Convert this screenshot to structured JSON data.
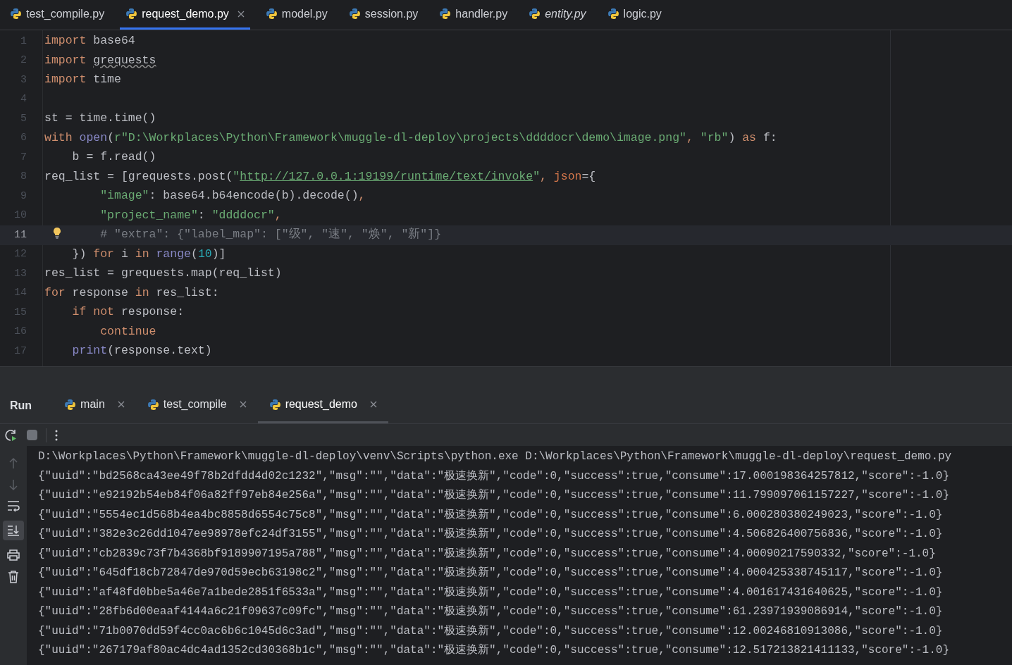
{
  "editor_tabs": [
    {
      "label": "test_compile.py",
      "selected": false,
      "preview": false
    },
    {
      "label": "request_demo.py",
      "selected": true,
      "preview": false
    },
    {
      "label": "model.py",
      "selected": false,
      "preview": false
    },
    {
      "label": "session.py",
      "selected": false,
      "preview": false
    },
    {
      "label": "handler.py",
      "selected": false,
      "preview": false
    },
    {
      "label": "entity.py",
      "selected": false,
      "preview": true
    },
    {
      "label": "logic.py",
      "selected": false,
      "preview": false
    }
  ],
  "code_lines": [
    {
      "number": "1",
      "current": false,
      "tokens": [
        {
          "kind": "kw",
          "text": "import "
        },
        {
          "kind": "plain",
          "text": "base64"
        }
      ]
    },
    {
      "number": "2",
      "current": false,
      "tokens": [
        {
          "kind": "kw",
          "text": "import "
        },
        {
          "kind": "warn",
          "text": "grequests"
        }
      ]
    },
    {
      "number": "3",
      "current": false,
      "tokens": [
        {
          "kind": "kw",
          "text": "import "
        },
        {
          "kind": "plain",
          "text": "time"
        }
      ]
    },
    {
      "number": "4",
      "current": false
    },
    {
      "number": "5",
      "current": false,
      "tokens": [
        {
          "kind": "plain",
          "text": "st = time.time()"
        }
      ]
    },
    {
      "number": "6",
      "current": false,
      "tokens": [
        {
          "kind": "kw",
          "text": "with "
        },
        {
          "kind": "fn",
          "text": "open"
        },
        {
          "kind": "plain",
          "text": "("
        },
        {
          "kind": "str",
          "text": "r\"D:\\Workplaces\\Python\\Framework\\muggle-dl-deploy\\projects\\ddddocr\\demo\\image.png\""
        },
        {
          "kind": "punct",
          "text": ", "
        },
        {
          "kind": "str",
          "text": "\"rb\""
        },
        {
          "kind": "plain",
          "text": ") "
        },
        {
          "kind": "kw",
          "text": "as "
        },
        {
          "kind": "plain",
          "text": "f:"
        }
      ]
    },
    {
      "number": "7",
      "current": false,
      "tokens": [
        {
          "kind": "plain",
          "text": "    b = f.read()"
        }
      ]
    },
    {
      "number": "8",
      "current": false,
      "tokens": [
        {
          "kind": "plain",
          "text": "req_list = [grequests.post("
        },
        {
          "kind": "str",
          "text": "\""
        },
        {
          "kind": "link",
          "text": "http://127.0.0.1:19199/runtime/text/invoke"
        },
        {
          "kind": "str",
          "text": "\""
        },
        {
          "kind": "punct",
          "text": ", "
        },
        {
          "kind": "param",
          "text": "json"
        },
        {
          "kind": "plain",
          "text": "={"
        }
      ]
    },
    {
      "number": "9",
      "current": false,
      "tokens": [
        {
          "kind": "str",
          "text": "        \"image\""
        },
        {
          "kind": "plain",
          "text": ": base64.b64encode(b).decode()"
        },
        {
          "kind": "punct",
          "text": ","
        }
      ]
    },
    {
      "number": "10",
      "current": false,
      "tokens": [
        {
          "kind": "str",
          "text": "        \"project_name\""
        },
        {
          "kind": "plain",
          "text": ": "
        },
        {
          "kind": "str",
          "text": "\"ddddocr\""
        },
        {
          "kind": "punct",
          "text": ","
        }
      ]
    },
    {
      "number": "11",
      "current": true,
      "bulb": true,
      "tokens": [
        {
          "kind": "comment",
          "text": "# \"extra\": {\"label_map\": [\"级\", \"速\", \"焕\", \"新\"]}"
        }
      ]
    },
    {
      "number": "12",
      "current": false,
      "tokens": [
        {
          "kind": "plain",
          "text": "    }) "
        },
        {
          "kind": "kw",
          "text": "for "
        },
        {
          "kind": "plain",
          "text": "i "
        },
        {
          "kind": "kw",
          "text": "in "
        },
        {
          "kind": "fn",
          "text": "range"
        },
        {
          "kind": "plain",
          "text": "("
        },
        {
          "kind": "num",
          "text": "10"
        },
        {
          "kind": "plain",
          "text": ")]"
        }
      ]
    },
    {
      "number": "13",
      "current": false,
      "tokens": [
        {
          "kind": "plain",
          "text": "res_list = grequests.map(req_list)"
        }
      ]
    },
    {
      "number": "14",
      "current": false,
      "tokens": [
        {
          "kind": "kw",
          "text": "for "
        },
        {
          "kind": "plain",
          "text": "response "
        },
        {
          "kind": "kw",
          "text": "in "
        },
        {
          "kind": "plain",
          "text": "res_list:"
        }
      ]
    },
    {
      "number": "15",
      "current": false,
      "tokens": [
        {
          "kind": "kw",
          "text": "    if not "
        },
        {
          "kind": "plain",
          "text": "response:"
        }
      ]
    },
    {
      "number": "16",
      "current": false,
      "tokens": [
        {
          "kind": "kw",
          "text": "        continue"
        }
      ]
    },
    {
      "number": "17",
      "current": false,
      "tokens": [
        {
          "kind": "fn",
          "text": "    print"
        },
        {
          "kind": "plain",
          "text": "(response.text)"
        }
      ]
    }
  ],
  "run_panel": {
    "title": "Run",
    "tabs": [
      {
        "label": "main",
        "selected": false
      },
      {
        "label": "test_compile",
        "selected": false
      },
      {
        "label": "request_demo",
        "selected": true
      }
    ],
    "output": [
      "D:\\Workplaces\\Python\\Framework\\muggle-dl-deploy\\venv\\Scripts\\python.exe D:\\Workplaces\\Python\\Framework\\muggle-dl-deploy\\request_demo.py",
      "{\"uuid\":\"bd2568ca43ee49f78b2dfdd4d02c1232\",\"msg\":\"\",\"data\":\"极速换新\",\"code\":0,\"success\":true,\"consume\":17.000198364257812,\"score\":-1.0}",
      "{\"uuid\":\"e92192b54eb84f06a82ff97eb84e256a\",\"msg\":\"\",\"data\":\"极速换新\",\"code\":0,\"success\":true,\"consume\":11.799097061157227,\"score\":-1.0}",
      "{\"uuid\":\"5554ec1d568b4ea4bc8858d6554c75c8\",\"msg\":\"\",\"data\":\"极速换新\",\"code\":0,\"success\":true,\"consume\":6.000280380249023,\"score\":-1.0}",
      "{\"uuid\":\"382e3c26dd1047ee98978efc24df3155\",\"msg\":\"\",\"data\":\"极速换新\",\"code\":0,\"success\":true,\"consume\":4.506826400756836,\"score\":-1.0}",
      "{\"uuid\":\"cb2839c73f7b4368bf9189907195a788\",\"msg\":\"\",\"data\":\"极速换新\",\"code\":0,\"success\":true,\"consume\":4.00090217590332,\"score\":-1.0}",
      "{\"uuid\":\"645df18cb72847de970d59ecb63198c2\",\"msg\":\"\",\"data\":\"极速换新\",\"code\":0,\"success\":true,\"consume\":4.000425338745117,\"score\":-1.0}",
      "{\"uuid\":\"af48fd0bbe5a46e7a1bede2851f6533a\",\"msg\":\"\",\"data\":\"极速换新\",\"code\":0,\"success\":true,\"consume\":4.001617431640625,\"score\":-1.0}",
      "{\"uuid\":\"28fb6d00eaaf4144a6c21f09637c09fc\",\"msg\":\"\",\"data\":\"极速换新\",\"code\":0,\"success\":true,\"consume\":61.23971939086914,\"score\":-1.0}",
      "{\"uuid\":\"71b0070dd59f4cc0ac6b6c1045d6c3ad\",\"msg\":\"\",\"data\":\"极速换新\",\"code\":0,\"success\":true,\"consume\":12.00246810913086,\"score\":-1.0}",
      "{\"uuid\":\"267179af80ac4dc4ad1352cd30368b1c\",\"msg\":\"\",\"data\":\"极速换新\",\"code\":0,\"success\":true,\"consume\":12.517213821411133,\"score\":-1.0}"
    ]
  }
}
